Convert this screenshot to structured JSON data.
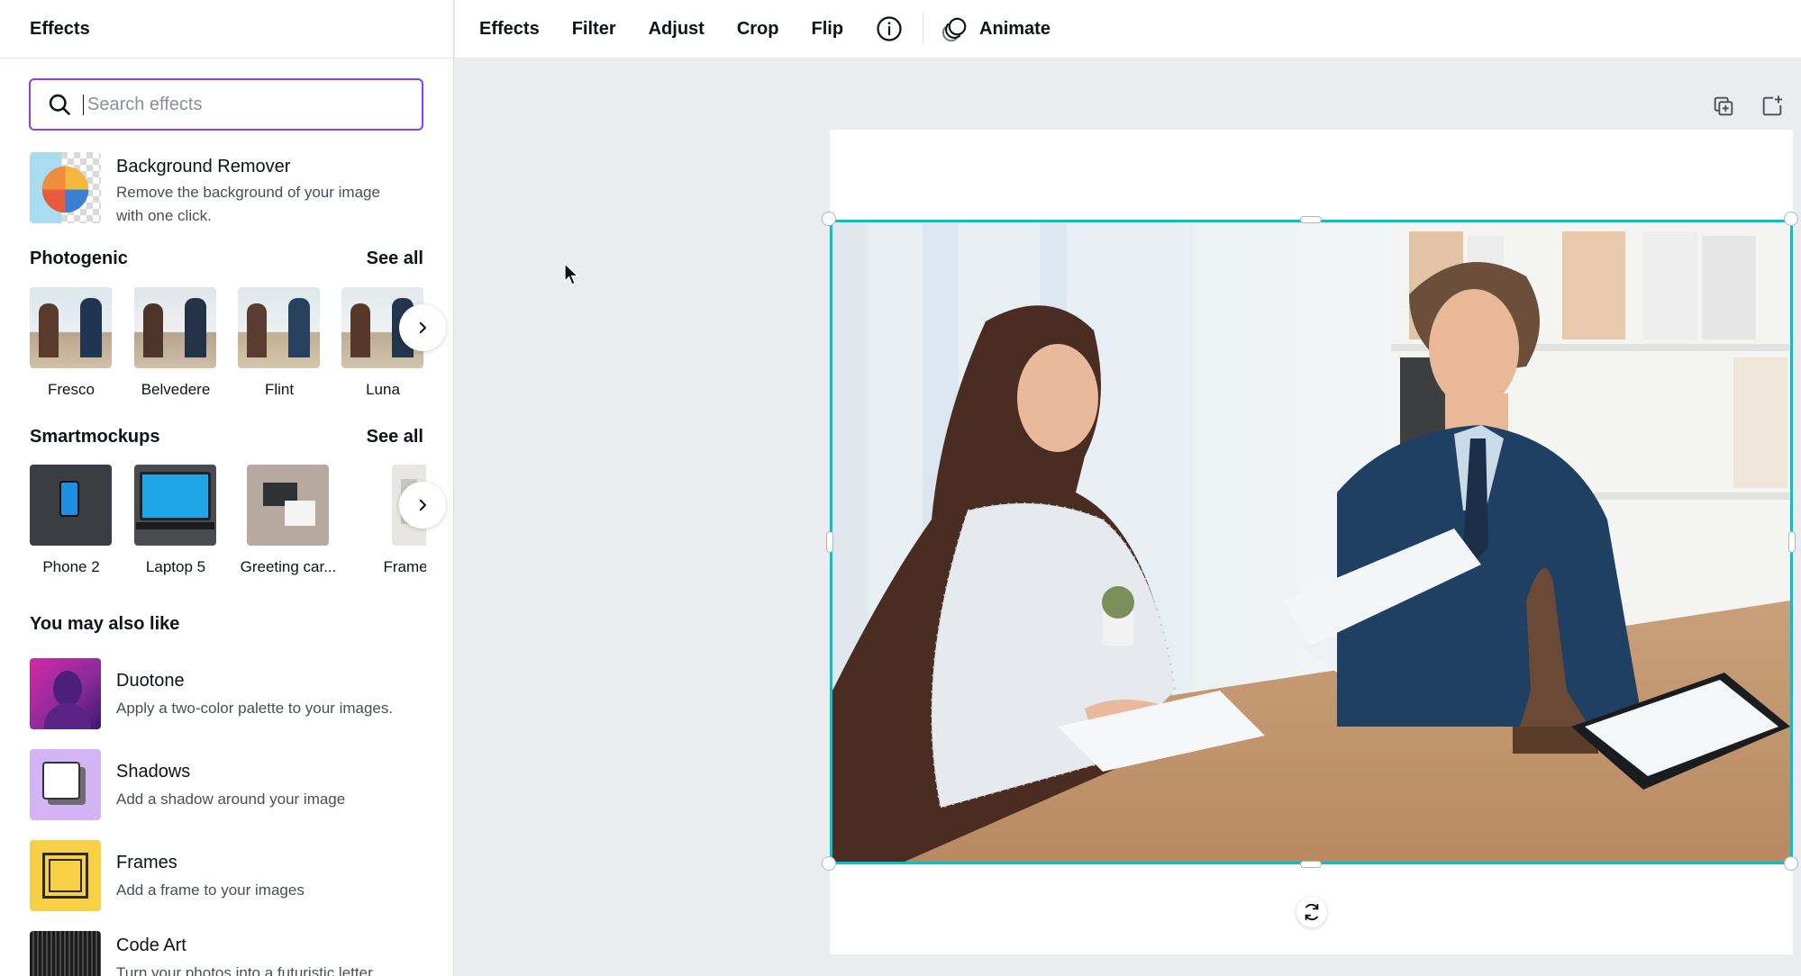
{
  "panel": {
    "title": "Effects",
    "search_placeholder": "Search effects",
    "featured": {
      "title": "Background Remover",
      "description_line1": "Remove the background of your image",
      "description_line2": "with one click."
    },
    "photogenic": {
      "heading": "Photogenic",
      "see_all": "See all",
      "items": [
        "Fresco",
        "Belvedere",
        "Flint",
        "Luna"
      ]
    },
    "smartmockups": {
      "heading": "Smartmockups",
      "see_all": "See all",
      "items": [
        "Phone 2",
        "Laptop 5",
        "Greeting car...",
        "Frame"
      ]
    },
    "also_like": {
      "heading": "You may also like",
      "items": [
        {
          "title": "Duotone",
          "description": "Apply a two-color palette to your images."
        },
        {
          "title": "Shadows",
          "description": "Add a shadow around your image"
        },
        {
          "title": "Frames",
          "description": "Add a frame to your images"
        },
        {
          "title": "Code Art",
          "description": "Turn your photos into a futuristic letter"
        }
      ]
    }
  },
  "toolbar": {
    "effects": "Effects",
    "filter": "Filter",
    "adjust": "Adjust",
    "crop": "Crop",
    "flip": "Flip",
    "animate": "Animate"
  },
  "colors": {
    "selection": "#00c4cc",
    "search_focus": "#8b3dff"
  },
  "icons": [
    "search-icon",
    "chevron-right-icon",
    "info-icon",
    "animate-icon",
    "duplicate-page-icon",
    "add-page-icon",
    "rotate-icon",
    "mouse-cursor-icon"
  ]
}
